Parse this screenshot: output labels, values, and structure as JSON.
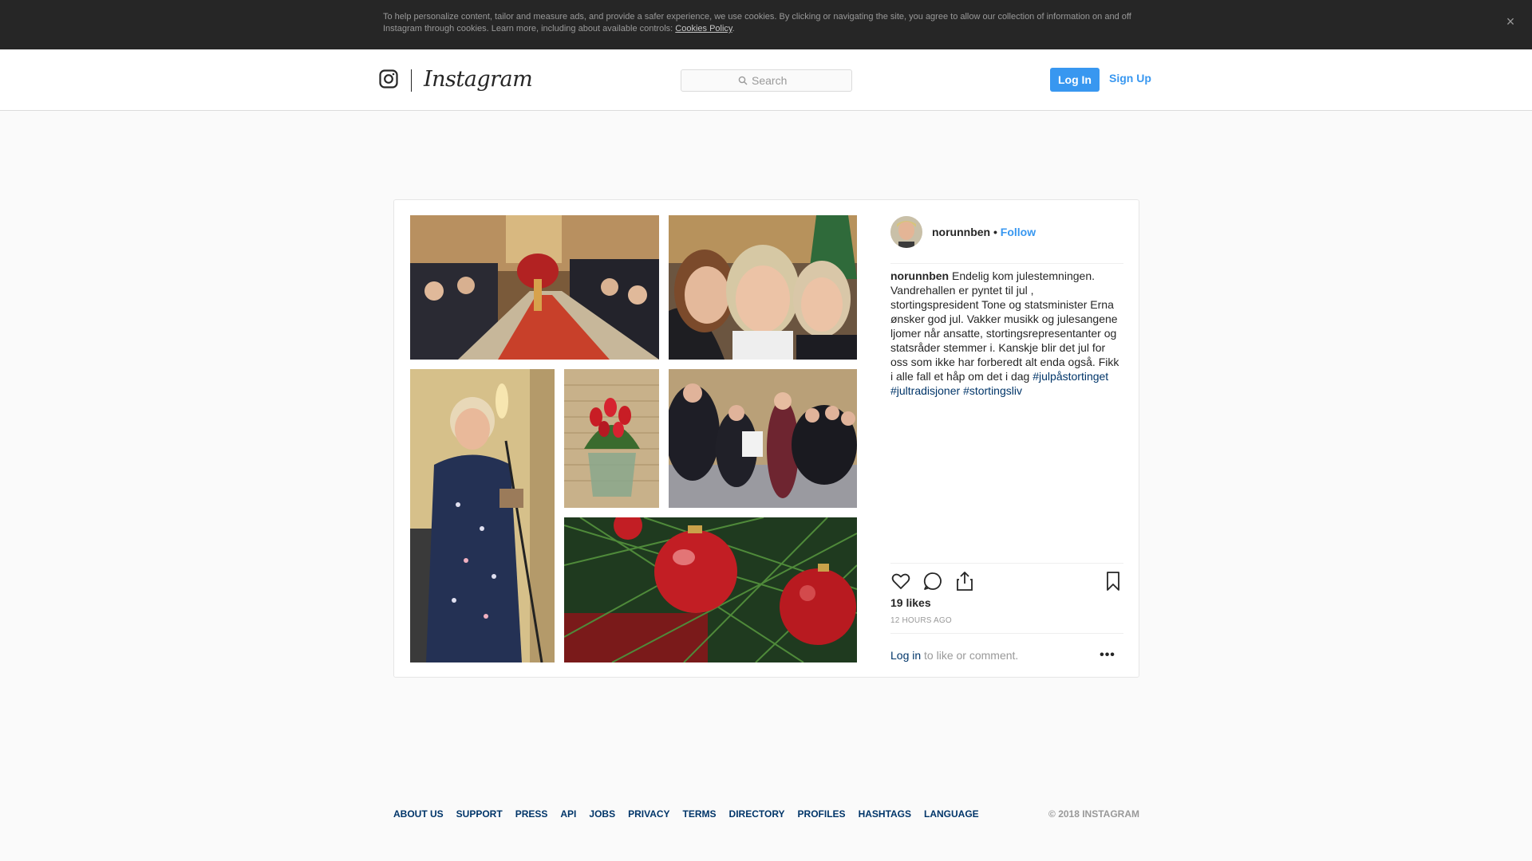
{
  "cookie_banner": {
    "text": "To help personalize content, tailor and measure ads, and provide a safer experience, we use cookies. By clicking or navigating the site, you agree to allow our collection of information on and off Instagram through cookies. Learn more, including about available controls: ",
    "link": "Cookies Policy",
    "suffix": ".",
    "close": "×"
  },
  "header": {
    "wordmark": "Instagram",
    "search_placeholder": "Search",
    "login": "Log In",
    "signup": "Sign Up"
  },
  "post": {
    "username": "norunnben",
    "separator": "•",
    "follow": "Follow",
    "caption": "Endelig kom julestemningen. Vandrehallen er pyntet til jul , stortingspresident Tone og statsminister Erna ønsker god jul. Vakker musikk og julesangene ljomer når ansatte, stortingsrepresentanter og statsråder stemmer i. Kanskje blir det jul for oss som ikke har forberedt alt enda også. Fikk i alle fall et håp om det i dag ",
    "hashtags": [
      "#julpåstortinget",
      "#jultradisjoner",
      "#stortingsliv"
    ],
    "likes": "19 likes",
    "time": "12 HOURS AGO",
    "login_link": "Log in",
    "comment_prompt": " to like or comment.",
    "more": "•••"
  },
  "footer": {
    "links": [
      "ABOUT US",
      "SUPPORT",
      "PRESS",
      "API",
      "JOBS",
      "PRIVACY",
      "TERMS",
      "DIRECTORY",
      "PROFILES",
      "HASHTAGS",
      "LANGUAGE"
    ],
    "copyright": "© 2018 INSTAGRAM"
  },
  "colors": {
    "accent": "#3897f0",
    "link_dark": "#003569",
    "banner": "#262626"
  }
}
